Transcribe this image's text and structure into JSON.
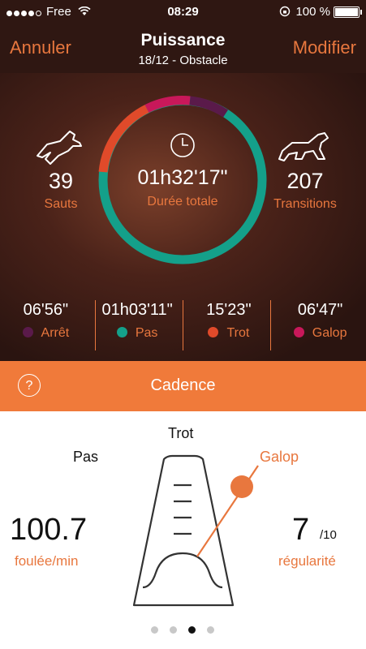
{
  "status_bar": {
    "carrier": "Free",
    "time": "08:29",
    "battery": "100 %"
  },
  "nav": {
    "cancel_label": "Annuler",
    "edit_label": "Modifier",
    "title": "Puissance",
    "subtitle": "18/12  - Obstacle"
  },
  "summary": {
    "jumps": {
      "value": "39",
      "label": "Sauts",
      "icon": "jumping-horse-icon"
    },
    "transitions": {
      "value": "207",
      "label": "Transitions",
      "icon": "galloping-horse-icon"
    },
    "total_duration": {
      "value": "01h32'17\"",
      "label": "Durée totale",
      "icon": "clock-icon"
    }
  },
  "gaits": [
    {
      "time": "06'56\"",
      "name": "Arrêt",
      "color": "#5a1a4a"
    },
    {
      "time": "01h03'11\"",
      "name": "Pas",
      "color": "#14a08a"
    },
    {
      "time": "15'23\"",
      "name": "Trot",
      "color": "#e04a2a"
    },
    {
      "time": "06'47\"",
      "name": "Galop",
      "color": "#c8185a"
    }
  ],
  "cadence": {
    "section_title": "Cadence",
    "help_icon": "help-icon",
    "label_pas": "Pas",
    "label_trot": "Trot",
    "label_galop": "Galop",
    "stride_value": "100.7",
    "stride_unit": "foulée/min",
    "regularity_value": "7",
    "regularity_scale": "/10",
    "regularity_label": "régularité",
    "metronome_icon": "metronome-icon"
  },
  "pager": {
    "pages": 4,
    "active": 3
  },
  "colors": {
    "accent": "#e8773e",
    "bar": "#f07a3a"
  }
}
